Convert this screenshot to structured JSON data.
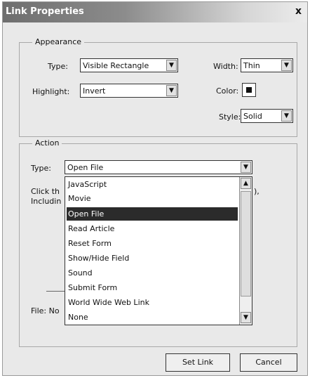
{
  "window": {
    "title": "Link Properties",
    "close_label": "x"
  },
  "appearance": {
    "legend": "Appearance",
    "type_label": "Type:",
    "type_value": "Visible Rectangle",
    "highlight_label": "Highlight:",
    "highlight_value": "Invert",
    "width_label": "Width:",
    "width_value": "Thin",
    "color_label": "Color:",
    "style_label": "Style:",
    "style_value": "Solid",
    "color_value": "#111111"
  },
  "action": {
    "legend": "Action",
    "type_label": "Type:",
    "type_value": "Open File",
    "desc_line1": "Click th",
    "desc_line2": "Includin",
    "desc_trail": "),",
    "file_label": "File: No",
    "options": [
      "JavaScript",
      "Movie",
      "Open File",
      "Read Article",
      "Reset Form",
      "Show/Hide Field",
      "Sound",
      "Submit Form",
      "World Wide Web Link",
      "None"
    ],
    "selected_option": "Open File"
  },
  "buttons": {
    "set_link": "Set Link",
    "cancel": "Cancel"
  },
  "icons": {
    "dropdown": "chevron-down-icon",
    "scroll_up": "arrow-up-icon",
    "scroll_down": "arrow-down-icon",
    "close": "close-icon"
  }
}
